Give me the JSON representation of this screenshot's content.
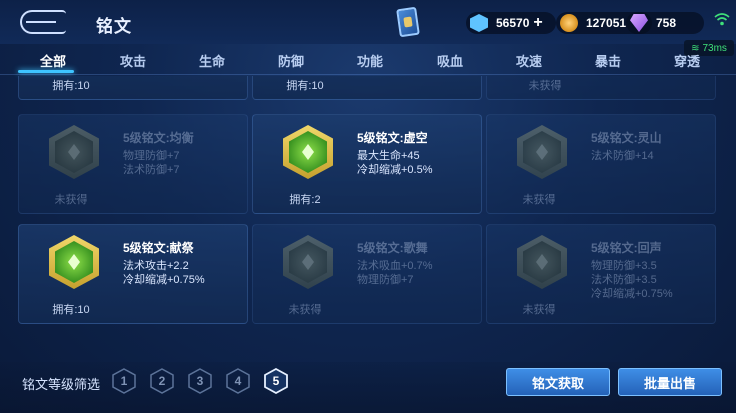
{
  "header": {
    "title": "铭文",
    "currencies": [
      {
        "icon": "gem-icon",
        "value": "56570"
      },
      {
        "icon": "gold-coin-icon",
        "value": "127051"
      },
      {
        "icon": "crystal-icon",
        "value": "758"
      }
    ],
    "ping": "73ms"
  },
  "tabs": [
    {
      "label": "全部",
      "active": true
    },
    {
      "label": "攻击"
    },
    {
      "label": "生命"
    },
    {
      "label": "防御"
    },
    {
      "label": "功能"
    },
    {
      "label": "吸血"
    },
    {
      "label": "攻速"
    },
    {
      "label": "暴击"
    },
    {
      "label": "穿透"
    }
  ],
  "partial_row": [
    "拥有:10",
    "拥有:10",
    "未获得"
  ],
  "runes": [
    {
      "title": "5级铭文:均衡",
      "stats": [
        "物理防御+7",
        "法术防御+7"
      ],
      "own": "未获得",
      "owned": false
    },
    {
      "title": "5级铭文:虚空",
      "stats": [
        "最大生命+45",
        "冷却缩减+0.5%"
      ],
      "own": "拥有:2",
      "owned": true
    },
    {
      "title": "5级铭文:灵山",
      "stats": [
        "法术防御+14"
      ],
      "own": "未获得",
      "owned": false
    },
    {
      "title": "5级铭文:献祭",
      "stats": [
        "法术攻击+2.2",
        "冷却缩减+0.75%"
      ],
      "own": "拥有:10",
      "owned": true
    },
    {
      "title": "5级铭文:歌舞",
      "stats": [
        "法术吸血+0.7%",
        "物理防御+7"
      ],
      "own": "未获得",
      "owned": false
    },
    {
      "title": "5级铭文:回声",
      "stats": [
        "物理防御+3.5",
        "法术防御+3.5",
        "冷却缩减+0.75%"
      ],
      "own": "未获得",
      "owned": false
    }
  ],
  "footer": {
    "filter_label": "铭文等级筛选",
    "levels": [
      "1",
      "2",
      "3",
      "4",
      "5"
    ],
    "active_level": "5",
    "obtain_button": "铭文获取",
    "sell_button": "批量出售"
  }
}
